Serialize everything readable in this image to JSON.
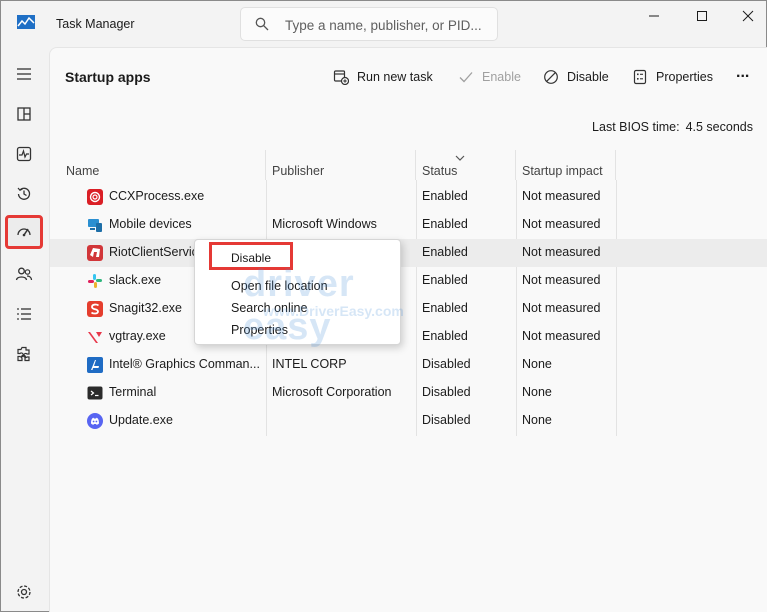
{
  "window": {
    "title": "Task Manager",
    "search_placeholder": "Type a name, publisher, or PID..."
  },
  "nav": {
    "items": [
      "hamburger-menu",
      "processes",
      "performance",
      "app-history",
      "startup-apps",
      "users",
      "details",
      "services",
      "settings"
    ],
    "active": "startup-apps",
    "highlight_color": "#e53935"
  },
  "header": {
    "title": "Startup apps",
    "run_new_task": "Run new task",
    "enable": "Enable",
    "disable": "Disable",
    "properties": "Properties",
    "more": "..."
  },
  "bios": {
    "label": "Last BIOS time:",
    "value": "4.5 seconds"
  },
  "table": {
    "columns": [
      "Name",
      "Publisher",
      "Status",
      "Startup impact"
    ],
    "rows": [
      {
        "name": "CCXProcess.exe",
        "publisher": "",
        "status": "Enabled",
        "impact": "Not measured",
        "icon": "adobe-cc-icon"
      },
      {
        "name": "Mobile devices",
        "publisher": "Microsoft Windows",
        "status": "Enabled",
        "impact": "Not measured",
        "icon": "mobile-devices-icon"
      },
      {
        "name": "RiotClientServices.exe",
        "publisher": "",
        "status": "Enabled",
        "impact": "Not measured",
        "icon": "riot-icon"
      },
      {
        "name": "slack.exe",
        "publisher": "",
        "status": "Enabled",
        "impact": "Not measured",
        "icon": "slack-icon"
      },
      {
        "name": "Snagit32.exe",
        "publisher": "",
        "status": "Enabled",
        "impact": "Not measured",
        "icon": "snagit-icon"
      },
      {
        "name": "vgtray.exe",
        "publisher": "",
        "status": "Enabled",
        "impact": "Not measured",
        "icon": "valorant-icon"
      },
      {
        "name": "Intel® Graphics Comman...",
        "publisher": "INTEL CORP",
        "status": "Disabled",
        "impact": "None",
        "icon": "intel-graphics-icon"
      },
      {
        "name": "Terminal",
        "publisher": "Microsoft Corporation",
        "status": "Disabled",
        "impact": "None",
        "icon": "terminal-icon"
      },
      {
        "name": "Update.exe",
        "publisher": "",
        "status": "Disabled",
        "impact": "None",
        "icon": "discord-icon"
      }
    ],
    "selected_row": 2
  },
  "context_menu": {
    "items": [
      "Disable",
      "Open file location",
      "Search online",
      "Properties"
    ]
  },
  "watermark": {
    "big": "driver easy",
    "small": "www.DriverEasy.com"
  }
}
